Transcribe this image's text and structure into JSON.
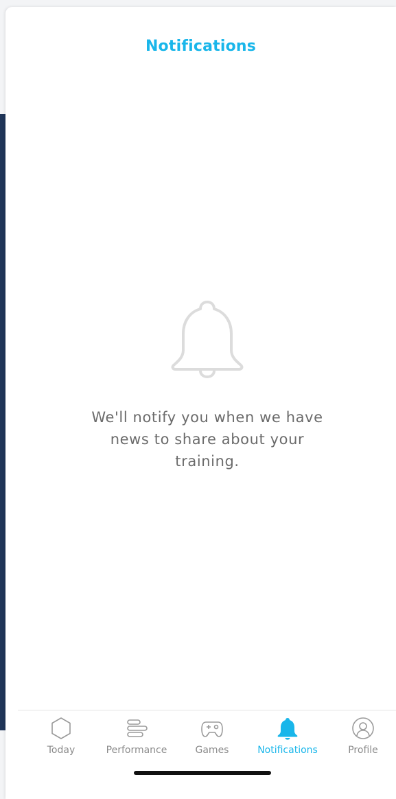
{
  "header": {
    "title": "Notifications"
  },
  "empty_state": {
    "icon": "bell-outline-icon",
    "line1": "We'll notify you when we have",
    "line2": "news to share about your",
    "line3": "training."
  },
  "tabbar": {
    "accent_color": "#19b6ea",
    "inactive_color": "#8b8b8b",
    "items": [
      {
        "label": "Today",
        "icon": "hexagon-icon",
        "active": false
      },
      {
        "label": "Performance",
        "icon": "bars-icon",
        "active": false
      },
      {
        "label": "Games",
        "icon": "gamepad-icon",
        "active": false
      },
      {
        "label": "Notifications",
        "icon": "bell-icon",
        "active": true
      },
      {
        "label": "Profile",
        "icon": "profile-icon",
        "active": false
      }
    ]
  }
}
